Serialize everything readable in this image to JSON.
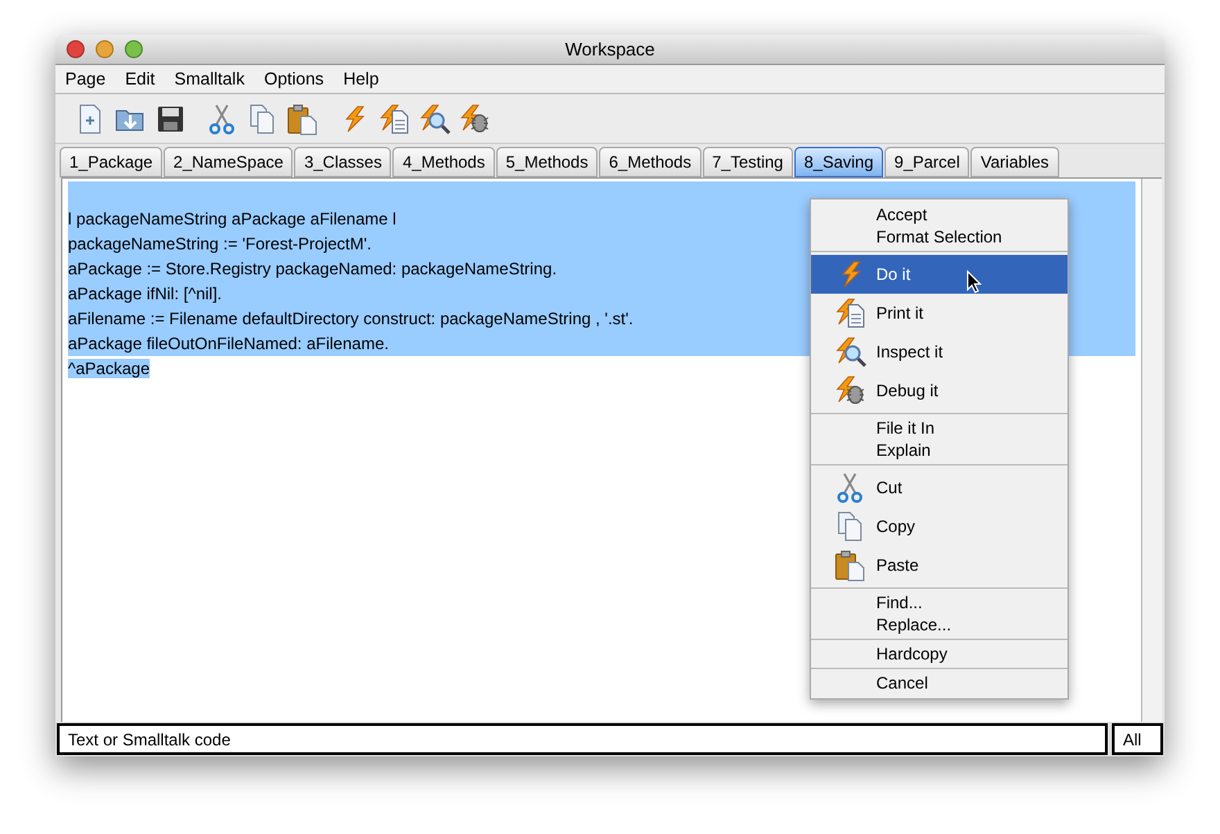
{
  "window": {
    "title": "Workspace"
  },
  "menu_bar": [
    "Page",
    "Edit",
    "Smalltalk",
    "Options",
    "Help"
  ],
  "tabs": [
    {
      "label": "1_Package",
      "selected": false
    },
    {
      "label": "2_NameSpace",
      "selected": false
    },
    {
      "label": "3_Classes",
      "selected": false
    },
    {
      "label": "4_Methods",
      "selected": false
    },
    {
      "label": "5_Methods",
      "selected": false
    },
    {
      "label": "6_Methods",
      "selected": false
    },
    {
      "label": "7_Testing",
      "selected": false
    },
    {
      "label": "8_Saving",
      "selected": true
    },
    {
      "label": "9_Parcel",
      "selected": false
    },
    {
      "label": "Variables",
      "selected": false
    }
  ],
  "editor": {
    "lines": [
      "l packageNameString aPackage aFilename l",
      "packageNameString := 'Forest-ProjectM'.",
      "aPackage := Store.Registry packageNamed: packageNameString.",
      "aPackage ifNil: [^nil].",
      "aFilename := Filename defaultDirectory construct: packageNameString , '.st'.",
      "aPackage fileOutOnFileNamed: aFilename.",
      "^aPackage"
    ]
  },
  "context_menu": [
    [
      {
        "label": "Accept",
        "selected": false
      },
      {
        "label": "Format Selection",
        "selected": false
      }
    ],
    [
      {
        "label": "Do it",
        "selected": true
      },
      {
        "label": "Print it",
        "selected": false
      },
      {
        "label": "Inspect it",
        "selected": false
      },
      {
        "label": "Debug it",
        "selected": false
      }
    ],
    [
      {
        "label": "File it In",
        "selected": false
      },
      {
        "label": "Explain",
        "selected": false
      }
    ],
    [
      {
        "label": "Cut",
        "selected": false
      },
      {
        "label": "Copy",
        "selected": false
      },
      {
        "label": "Paste",
        "selected": false
      }
    ],
    [
      {
        "label": "Find...",
        "selected": false
      },
      {
        "label": "Replace...",
        "selected": false
      }
    ],
    [
      {
        "label": "Hardcopy",
        "selected": false
      }
    ],
    [
      {
        "label": "Cancel",
        "selected": false
      }
    ]
  ],
  "status_bar": {
    "text": "Text or Smalltalk code",
    "scope": "All"
  }
}
